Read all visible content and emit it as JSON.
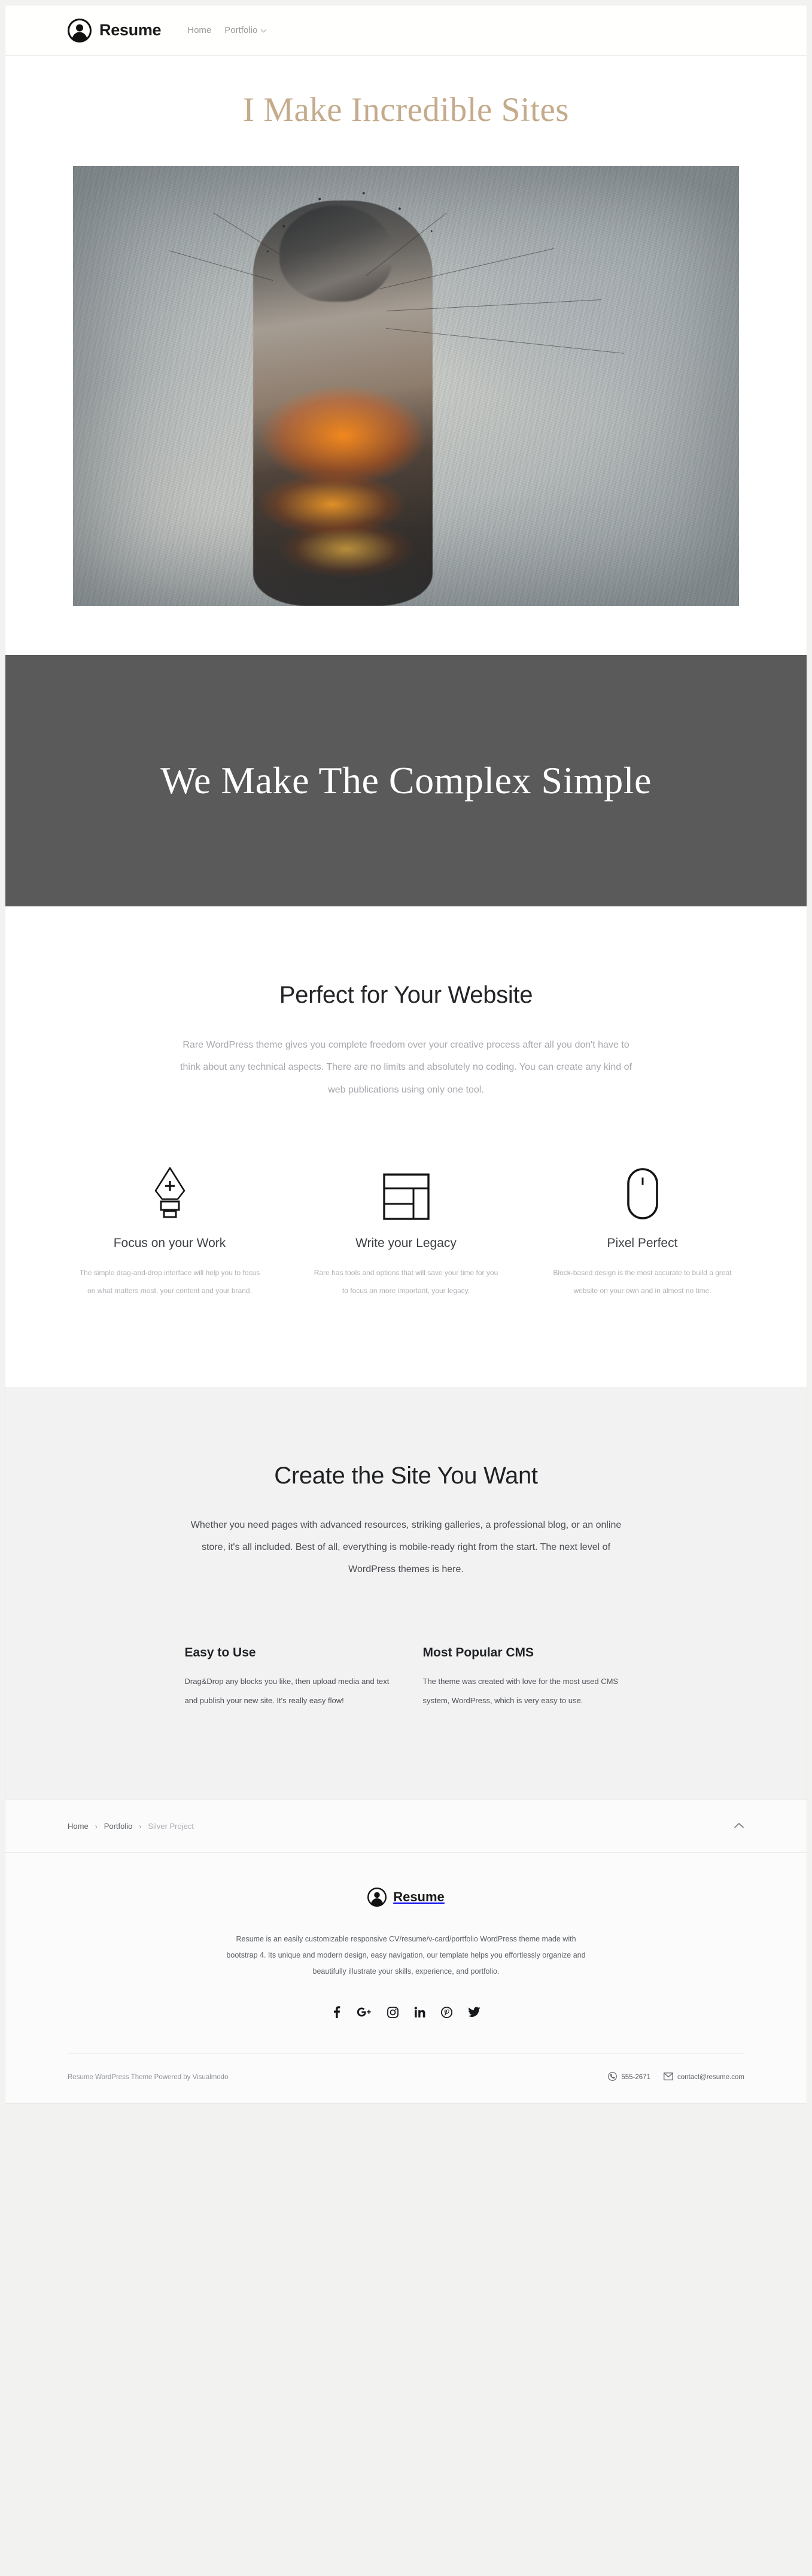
{
  "navbar": {
    "brand_label": "Resume",
    "brand_icon": "user-avatar-icon",
    "links": [
      {
        "label": "Home",
        "has_caret": false
      },
      {
        "label": "Portfolio",
        "has_caret": true
      }
    ]
  },
  "hero": {
    "title": "I Make Incredible Sites",
    "title_color": "#c4ab8b",
    "image_alt": "Abstract digital artwork of a burning figure dispersing into ash and sparks"
  },
  "band_dark": {
    "title": "We Make The Complex Simple",
    "background": "#5a5a5a",
    "text_color": "#ffffff"
  },
  "perfect_section": {
    "title": "Perfect for Your Website",
    "lead": "Rare WordPress theme gives you complete freedom over your creative process after all you don't have to think about any technical aspects. There are no limits and absolutely no coding. You can create any kind of web publications using only one tool.",
    "features": [
      {
        "icon": "pen-nib-icon",
        "title": "Focus on your Work",
        "text": "The simple drag-and-drop interface will help you to focus on what matters most, your content and your brand."
      },
      {
        "icon": "layout-grid-icon",
        "title": "Write your Legacy",
        "text": "Rare has tools and options that will save your time for you to focus on more important, your legacy."
      },
      {
        "icon": "computer-mouse-icon",
        "title": "Pixel Perfect",
        "text": "Block-based design is the most accurate to build a great website on your own and in almost no time."
      }
    ]
  },
  "create_section": {
    "background": "#f2f2f2",
    "title": "Create the Site You Want",
    "lead": "Whether you need pages with advanced resources, striking galleries, a professional blog, or an online store, it's all included. Best of all, everything is mobile-ready right from the start. The next level of WordPress themes is here.",
    "columns": [
      {
        "title": "Easy to Use",
        "text": "Drag&Drop any blocks you like, then upload media and text and publish your new site. It's really easy flow!"
      },
      {
        "title": "Most Popular CMS",
        "text": "The theme was created with love for the most used CMS system, WordPress, which is very easy to use."
      }
    ]
  },
  "breadcrumb": {
    "items": [
      {
        "label": "Home",
        "current": false
      },
      {
        "label": "Portfolio",
        "current": false
      },
      {
        "label": "Silver Project",
        "current": true
      }
    ],
    "separator": "›",
    "to_top_icon": "chevron-up-icon"
  },
  "footer": {
    "brand_label": "Resume",
    "brand_icon": "user-avatar-icon",
    "about": "Resume is an easily customizable responsive CV/resume/v-card/portfolio WordPress theme made with bootstrap 4. Its unique and modern design, easy navigation, our template helps you effortlessly organize and beautifully illustrate your skills, experience, and portfolio.",
    "socials": [
      {
        "name": "facebook-icon",
        "label": "f"
      },
      {
        "name": "google-plus-icon",
        "label": "G+"
      },
      {
        "name": "instagram-icon",
        "label": "Instagram"
      },
      {
        "name": "linkedin-icon",
        "label": "in"
      },
      {
        "name": "pinterest-icon",
        "label": "Pinterest"
      },
      {
        "name": "twitter-icon",
        "label": "Twitter"
      }
    ],
    "copyright": "Resume WordPress Theme Powered by Visualmodo",
    "phone": "555-2671",
    "phone_icon": "phone-icon",
    "email": "contact@resume.com",
    "email_icon": "envelope-icon"
  }
}
